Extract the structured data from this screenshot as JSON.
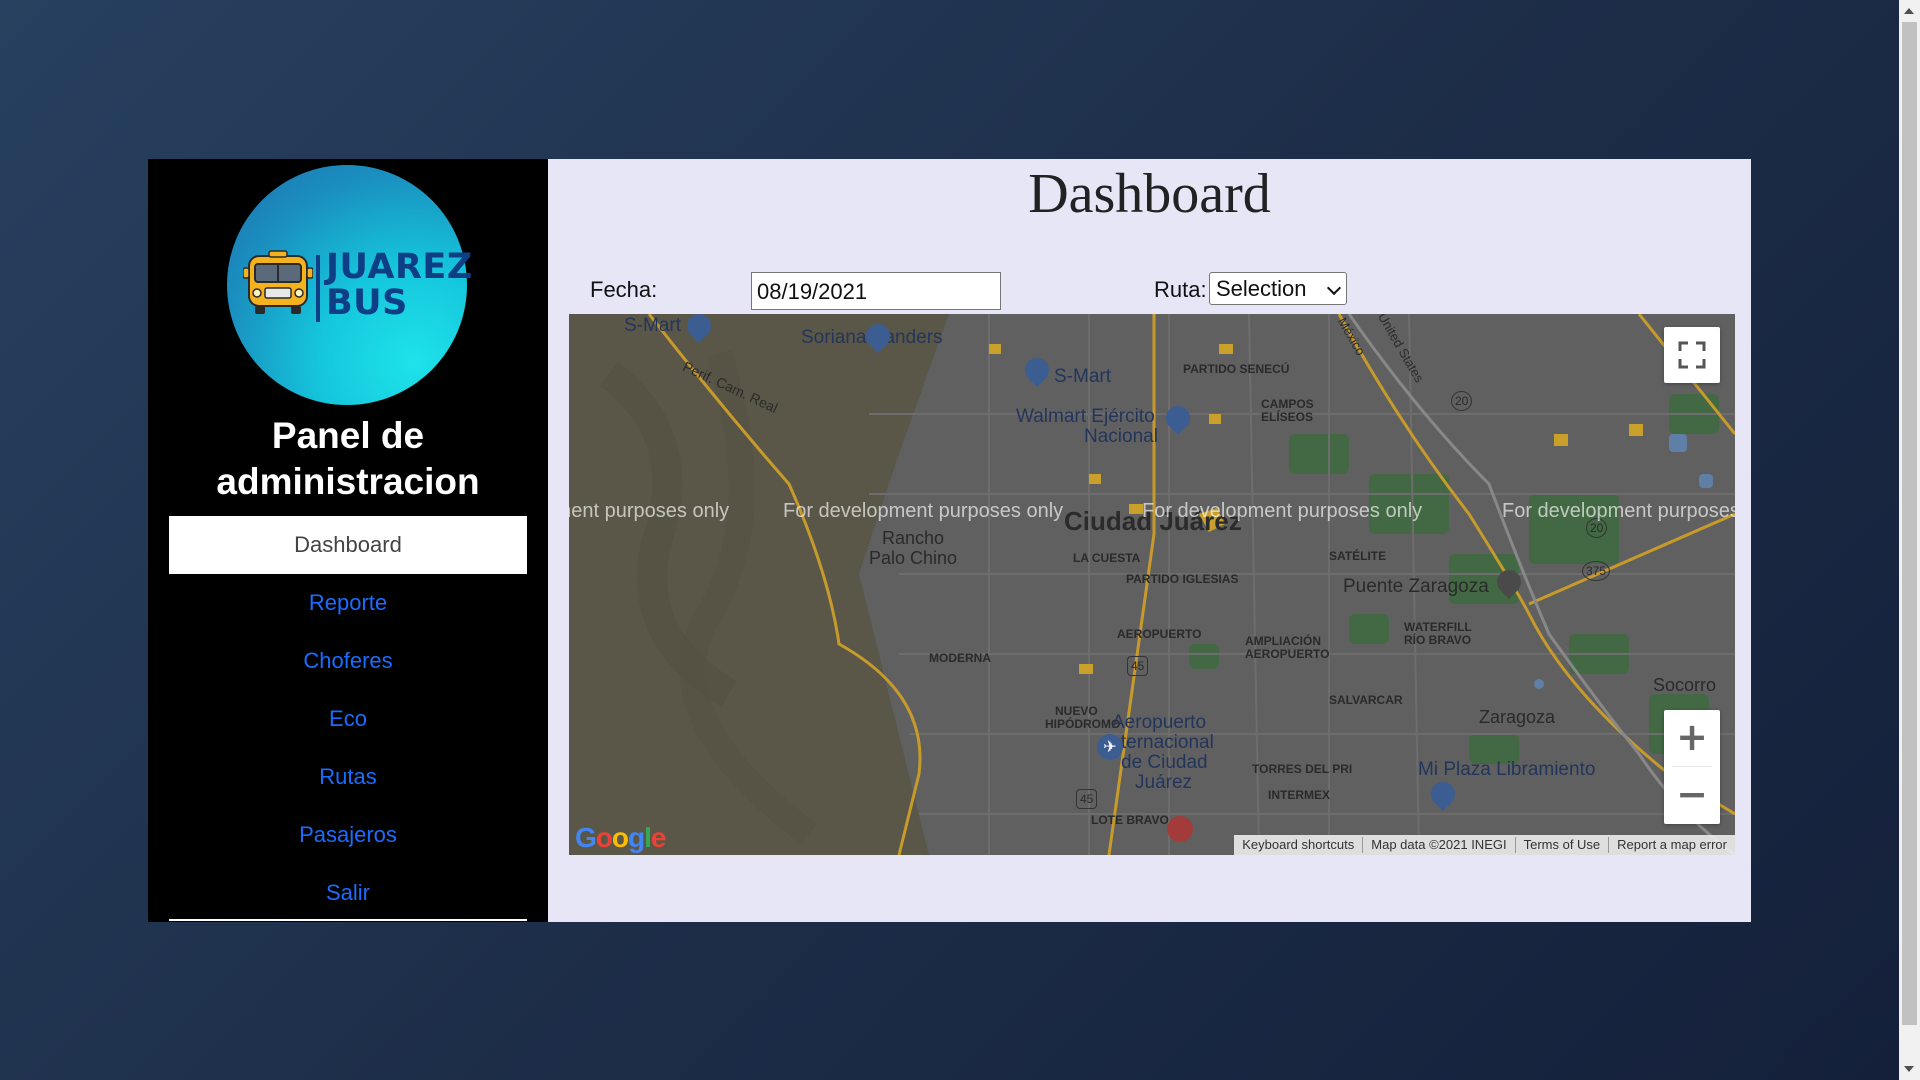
{
  "colors": {
    "page_bg": "#1f2f4b",
    "sidebar_bg": "#000000",
    "main_bg": "#e6e6f7",
    "nav_link": "#1a6cff",
    "active_nav_bg": "#ffffff"
  },
  "sidebar": {
    "logo_text_line1": "JUAREZ",
    "logo_text_line2": "BUS",
    "logo_icon": "school-bus-icon",
    "title": "Panel de administracion",
    "items": [
      {
        "label": "Dashboard",
        "active": true
      },
      {
        "label": "Reporte",
        "active": false
      },
      {
        "label": "Choferes",
        "active": false
      },
      {
        "label": "Eco",
        "active": false
      },
      {
        "label": "Rutas",
        "active": false
      },
      {
        "label": "Pasajeros",
        "active": false
      },
      {
        "label": "Salir",
        "active": false
      }
    ]
  },
  "main": {
    "title": "Dashboard",
    "date_label": "Fecha:",
    "date_value": "08/19/2021",
    "route_label": "Ruta:",
    "route_selected": "Selection"
  },
  "map": {
    "dev_watermark": "For development purposes only",
    "labels": {
      "city": "Ciudad Juárez",
      "rancho": "Rancho",
      "palo_chino": "Palo Chino",
      "la_cuesta": "LA CUESTA",
      "partido_iglesias": "PARTIDO IGLESIAS",
      "aeropuerto_col": "AEROPUERTO",
      "moderna": "MODERNA",
      "nuevo": "NUEVO",
      "hipodromo": "HIPÓDROMO",
      "lote_bravo": "LOTE BRAVO",
      "torres": "TORRES DEL PRI",
      "intermex": "INTERMEX",
      "salvarcar": "SALVARCAR",
      "ampliacion": "AMPLIACIÓN",
      "aeropuerto2": "AEROPUERTO",
      "waterfill": "WATERFILL",
      "rio_bravo": "RÍO BRAVO",
      "satelite": "SATÉLITE",
      "puente_zaragoza": "Puente Zaragoza",
      "zaragoza": "Zaragoza",
      "socorro": "Socorro",
      "partido_seneco": "PARTIDO SENECÚ",
      "campos": "CAMPOS",
      "eliseos": "ELÍSEOS",
      "periferico": "Perif. Cam. Real",
      "mexico": "México",
      "united_states": "United States",
      "aeropuerto_int_1": "Aeropuerto",
      "aeropuerto_int_2": "Internacional",
      "aeropuerto_int_3": "de Ciudad",
      "aeropuerto_int_4": "Juárez",
      "smart1": "S-Mart",
      "soriana": "Soriana Sanders",
      "smart2": "S-Mart",
      "walmart1": "Walmart Ejército",
      "walmart2": "Nacional",
      "mi_plaza": "Mi Plaza Libramiento",
      "hwy20a": "20",
      "hwy20b": "20",
      "hwy375": "375",
      "hwy45a": "45",
      "hwy45b": "45"
    },
    "google_logo": "Google",
    "attribution": {
      "keyboard": "Keyboard shortcuts",
      "map_data": "Map data ©2021 INEGI",
      "terms": "Terms of Use",
      "report": "Report a map error"
    },
    "zoom_in_label": "+",
    "zoom_out_label": "−"
  }
}
